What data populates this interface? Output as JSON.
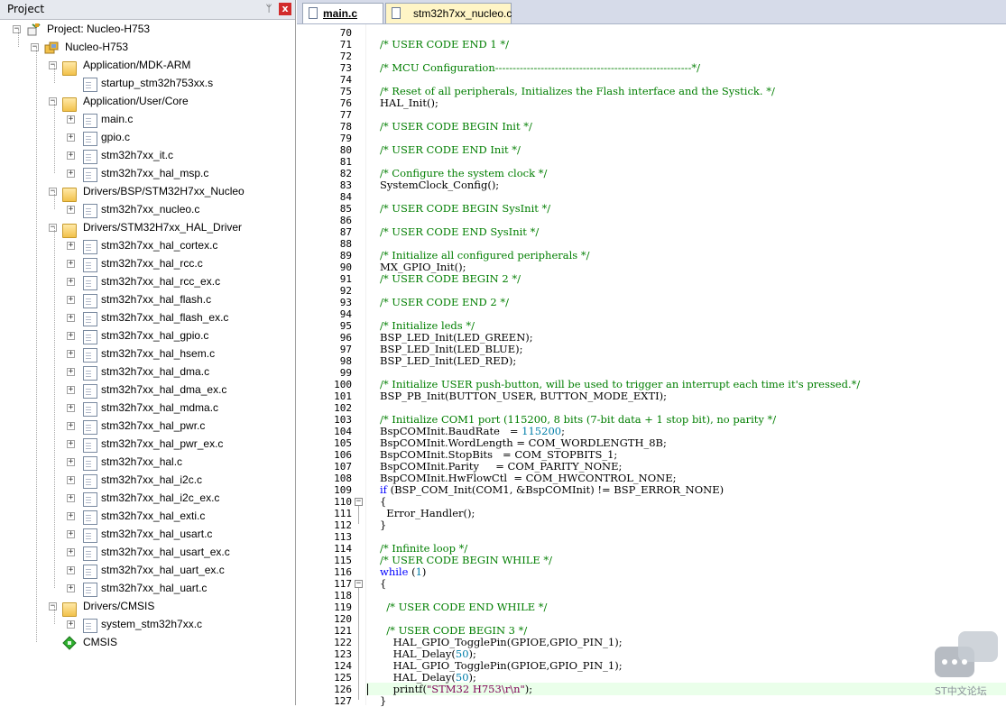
{
  "project_panel": {
    "title": "Project",
    "pin_glyph": "ᛘ",
    "close_glyph": "x",
    "tree": [
      {
        "label": "Project: Nucleo-H753",
        "kind": "project-root",
        "depth": 0,
        "toggle": "-"
      },
      {
        "label": "Nucleo-H753",
        "kind": "target",
        "depth": 1,
        "toggle": "-"
      },
      {
        "label": "Application/MDK-ARM",
        "kind": "folder",
        "depth": 2,
        "toggle": "-"
      },
      {
        "label": "startup_stm32h753xx.s",
        "kind": "file",
        "depth": 3,
        "toggle": ""
      },
      {
        "label": "Application/User/Core",
        "kind": "folder",
        "depth": 2,
        "toggle": "-"
      },
      {
        "label": "main.c",
        "kind": "file",
        "depth": 3,
        "toggle": "+"
      },
      {
        "label": "gpio.c",
        "kind": "file",
        "depth": 3,
        "toggle": "+"
      },
      {
        "label": "stm32h7xx_it.c",
        "kind": "file",
        "depth": 3,
        "toggle": "+"
      },
      {
        "label": "stm32h7xx_hal_msp.c",
        "kind": "file",
        "depth": 3,
        "toggle": "+"
      },
      {
        "label": "Drivers/BSP/STM32H7xx_Nucleo",
        "kind": "folder",
        "depth": 2,
        "toggle": "-"
      },
      {
        "label": "stm32h7xx_nucleo.c",
        "kind": "file",
        "depth": 3,
        "toggle": "+"
      },
      {
        "label": "Drivers/STM32H7xx_HAL_Driver",
        "kind": "folder",
        "depth": 2,
        "toggle": "-"
      },
      {
        "label": "stm32h7xx_hal_cortex.c",
        "kind": "file",
        "depth": 3,
        "toggle": "+"
      },
      {
        "label": "stm32h7xx_hal_rcc.c",
        "kind": "file",
        "depth": 3,
        "toggle": "+"
      },
      {
        "label": "stm32h7xx_hal_rcc_ex.c",
        "kind": "file",
        "depth": 3,
        "toggle": "+"
      },
      {
        "label": "stm32h7xx_hal_flash.c",
        "kind": "file",
        "depth": 3,
        "toggle": "+"
      },
      {
        "label": "stm32h7xx_hal_flash_ex.c",
        "kind": "file",
        "depth": 3,
        "toggle": "+"
      },
      {
        "label": "stm32h7xx_hal_gpio.c",
        "kind": "file",
        "depth": 3,
        "toggle": "+"
      },
      {
        "label": "stm32h7xx_hal_hsem.c",
        "kind": "file",
        "depth": 3,
        "toggle": "+"
      },
      {
        "label": "stm32h7xx_hal_dma.c",
        "kind": "file",
        "depth": 3,
        "toggle": "+"
      },
      {
        "label": "stm32h7xx_hal_dma_ex.c",
        "kind": "file",
        "depth": 3,
        "toggle": "+"
      },
      {
        "label": "stm32h7xx_hal_mdma.c",
        "kind": "file",
        "depth": 3,
        "toggle": "+"
      },
      {
        "label": "stm32h7xx_hal_pwr.c",
        "kind": "file",
        "depth": 3,
        "toggle": "+"
      },
      {
        "label": "stm32h7xx_hal_pwr_ex.c",
        "kind": "file",
        "depth": 3,
        "toggle": "+"
      },
      {
        "label": "stm32h7xx_hal.c",
        "kind": "file",
        "depth": 3,
        "toggle": "+"
      },
      {
        "label": "stm32h7xx_hal_i2c.c",
        "kind": "file",
        "depth": 3,
        "toggle": "+"
      },
      {
        "label": "stm32h7xx_hal_i2c_ex.c",
        "kind": "file",
        "depth": 3,
        "toggle": "+"
      },
      {
        "label": "stm32h7xx_hal_exti.c",
        "kind": "file",
        "depth": 3,
        "toggle": "+"
      },
      {
        "label": "stm32h7xx_hal_usart.c",
        "kind": "file",
        "depth": 3,
        "toggle": "+"
      },
      {
        "label": "stm32h7xx_hal_usart_ex.c",
        "kind": "file",
        "depth": 3,
        "toggle": "+"
      },
      {
        "label": "stm32h7xx_hal_uart_ex.c",
        "kind": "file",
        "depth": 3,
        "toggle": "+"
      },
      {
        "label": "stm32h7xx_hal_uart.c",
        "kind": "file",
        "depth": 3,
        "toggle": "+"
      },
      {
        "label": "Drivers/CMSIS",
        "kind": "folder",
        "depth": 2,
        "toggle": "-"
      },
      {
        "label": "system_stm32h7xx.c",
        "kind": "file",
        "depth": 3,
        "toggle": "+"
      },
      {
        "label": "CMSIS",
        "kind": "component",
        "depth": 2,
        "toggle": ""
      }
    ]
  },
  "tabs": [
    {
      "label": "main.c",
      "active": true
    },
    {
      "label": "stm32h7xx_nucleo.c",
      "active": false
    }
  ],
  "editor": {
    "lines": [
      {
        "n": "70",
        "parts": []
      },
      {
        "n": "71",
        "parts": [
          [
            "cm",
            "/* USER CODE END 1 */"
          ]
        ]
      },
      {
        "n": "72",
        "parts": []
      },
      {
        "n": "73",
        "parts": [
          [
            "cm",
            "/* MCU Configuration--------------------------------------------------------*/"
          ]
        ]
      },
      {
        "n": "74",
        "parts": []
      },
      {
        "n": "75",
        "parts": [
          [
            "cm",
            "/* Reset of all peripherals, Initializes the Flash interface and the Systick. */"
          ]
        ]
      },
      {
        "n": "76",
        "parts": [
          [
            "pl",
            "HAL_Init();"
          ]
        ]
      },
      {
        "n": "77",
        "parts": []
      },
      {
        "n": "78",
        "parts": [
          [
            "cm",
            "/* USER CODE BEGIN Init */"
          ]
        ]
      },
      {
        "n": "79",
        "parts": []
      },
      {
        "n": "80",
        "parts": [
          [
            "cm",
            "/* USER CODE END Init */"
          ]
        ]
      },
      {
        "n": "81",
        "parts": []
      },
      {
        "n": "82",
        "parts": [
          [
            "cm",
            "/* Configure the system clock */"
          ]
        ]
      },
      {
        "n": "83",
        "parts": [
          [
            "pl",
            "SystemClock_Config();"
          ]
        ]
      },
      {
        "n": "84",
        "parts": []
      },
      {
        "n": "85",
        "parts": [
          [
            "cm",
            "/* USER CODE BEGIN SysInit */"
          ]
        ]
      },
      {
        "n": "86",
        "parts": []
      },
      {
        "n": "87",
        "parts": [
          [
            "cm",
            "/* USER CODE END SysInit */"
          ]
        ]
      },
      {
        "n": "88",
        "parts": []
      },
      {
        "n": "89",
        "parts": [
          [
            "cm",
            "/* Initialize all configured peripherals */"
          ]
        ]
      },
      {
        "n": "90",
        "parts": [
          [
            "pl",
            "MX_GPIO_Init();"
          ]
        ]
      },
      {
        "n": "91",
        "parts": [
          [
            "cm",
            "/* USER CODE BEGIN 2 */"
          ]
        ]
      },
      {
        "n": "92",
        "parts": []
      },
      {
        "n": "93",
        "parts": [
          [
            "cm",
            "/* USER CODE END 2 */"
          ]
        ]
      },
      {
        "n": "94",
        "parts": []
      },
      {
        "n": "95",
        "parts": [
          [
            "cm",
            "/* Initialize leds */"
          ]
        ]
      },
      {
        "n": "96",
        "parts": [
          [
            "pl",
            "BSP_LED_Init(LED_GREEN);"
          ]
        ]
      },
      {
        "n": "97",
        "parts": [
          [
            "pl",
            "BSP_LED_Init(LED_BLUE);"
          ]
        ]
      },
      {
        "n": "98",
        "parts": [
          [
            "pl",
            "BSP_LED_Init(LED_RED);"
          ]
        ]
      },
      {
        "n": "99",
        "parts": []
      },
      {
        "n": "100",
        "parts": [
          [
            "cm",
            "/* Initialize USER push-button, will be used to trigger an interrupt each time it's pressed.*/"
          ]
        ]
      },
      {
        "n": "101",
        "parts": [
          [
            "pl",
            "BSP_PB_Init(BUTTON_USER, BUTTON_MODE_EXTI);"
          ]
        ]
      },
      {
        "n": "102",
        "parts": []
      },
      {
        "n": "103",
        "parts": [
          [
            "cm",
            "/* Initialize COM1 port (115200, 8 bits (7-bit data + 1 stop bit), no parity */"
          ]
        ]
      },
      {
        "n": "104",
        "parts": [
          [
            "pl",
            "BspCOMInit.BaudRate   = "
          ],
          [
            "nm",
            "115200"
          ],
          [
            "pl",
            ";"
          ]
        ]
      },
      {
        "n": "105",
        "parts": [
          [
            "pl",
            "BspCOMInit.WordLength = COM_WORDLENGTH_8B;"
          ]
        ]
      },
      {
        "n": "106",
        "parts": [
          [
            "pl",
            "BspCOMInit.StopBits   = COM_STOPBITS_1;"
          ]
        ]
      },
      {
        "n": "107",
        "parts": [
          [
            "pl",
            "BspCOMInit.Parity     = COM_PARITY_NONE;"
          ]
        ]
      },
      {
        "n": "108",
        "parts": [
          [
            "pl",
            "BspCOMInit.HwFlowCtl  = COM_HWCONTROL_NONE;"
          ]
        ]
      },
      {
        "n": "109",
        "parts": [
          [
            "kw",
            "if"
          ],
          [
            "pl",
            " (BSP_COM_Init(COM1, &BspCOMInit) != BSP_ERROR_NONE)"
          ]
        ]
      },
      {
        "n": "110",
        "parts": [
          [
            "pl",
            "{"
          ]
        ]
      },
      {
        "n": "111",
        "parts": [
          [
            "pl",
            "  Error_Handler();"
          ]
        ]
      },
      {
        "n": "112",
        "parts": [
          [
            "pl",
            "}"
          ]
        ]
      },
      {
        "n": "113",
        "parts": []
      },
      {
        "n": "114",
        "parts": [
          [
            "cm",
            "/* Infinite loop */"
          ]
        ]
      },
      {
        "n": "115",
        "parts": [
          [
            "cm",
            "/* USER CODE BEGIN WHILE */"
          ]
        ]
      },
      {
        "n": "116",
        "parts": [
          [
            "kw",
            "while"
          ],
          [
            "pl",
            " ("
          ],
          [
            "nm",
            "1"
          ],
          [
            "pl",
            ")"
          ]
        ]
      },
      {
        "n": "117",
        "parts": [
          [
            "pl",
            "{"
          ]
        ]
      },
      {
        "n": "118",
        "parts": []
      },
      {
        "n": "119",
        "parts": [
          [
            "cm",
            "  /* USER CODE END WHILE */"
          ]
        ]
      },
      {
        "n": "120",
        "parts": []
      },
      {
        "n": "121",
        "parts": [
          [
            "cm",
            "  /* USER CODE BEGIN 3 */"
          ]
        ]
      },
      {
        "n": "122",
        "parts": [
          [
            "pl",
            "    HAL_GPIO_TogglePin(GPIOE,GPIO_PIN_1);"
          ]
        ]
      },
      {
        "n": "123",
        "parts": [
          [
            "pl",
            "    HAL_Delay("
          ],
          [
            "nm",
            "50"
          ],
          [
            "pl",
            ");"
          ]
        ]
      },
      {
        "n": "124",
        "parts": [
          [
            "pl",
            "    HAL_GPIO_TogglePin(GPIOE,GPIO_PIN_1);"
          ]
        ]
      },
      {
        "n": "125",
        "parts": [
          [
            "pl",
            "    HAL_Delay("
          ],
          [
            "nm",
            "50"
          ],
          [
            "pl",
            ");"
          ]
        ]
      },
      {
        "n": "126",
        "parts": [
          [
            "pl",
            "    printf("
          ],
          [
            "st",
            "\"STM32 H753\\r\\n\""
          ],
          [
            "pl",
            ");"
          ]
        ]
      },
      {
        "n": "127",
        "parts": [
          [
            "pl",
            "}"
          ]
        ]
      }
    ],
    "fold_markers": [
      {
        "line": "110",
        "glyph": "-"
      },
      {
        "line": "117",
        "glyph": "-"
      }
    ],
    "highlighted_line": "126"
  },
  "watermark": {
    "text": "ST中文论坛"
  },
  "colors": {
    "comment": "#007e00",
    "keyword": "#0000ff",
    "number": "#007faa",
    "string": "#7f0055",
    "active_line": "#eaffea",
    "tab_active_bg": "#ffffff",
    "tab_inactive_bg": "#fff5c6"
  }
}
